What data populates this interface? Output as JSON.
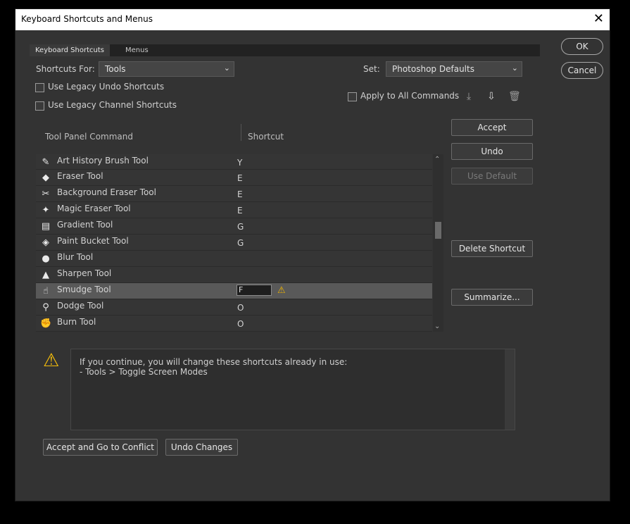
{
  "window": {
    "title": "Keyboard Shortcuts and Menus",
    "close_glyph": "✕"
  },
  "tabs": [
    {
      "label": "Keyboard Shortcuts",
      "active": true
    },
    {
      "label": "Menus",
      "active": false
    }
  ],
  "shortcuts_for": {
    "label": "Shortcuts For:",
    "value": "Tools"
  },
  "set": {
    "label": "Set:",
    "value": "Photoshop Defaults"
  },
  "options": {
    "legacy_undo": "Use Legacy Undo Shortcuts",
    "legacy_channel": "Use Legacy Channel Shortcuts",
    "apply_all": "Apply to All Commands"
  },
  "columns": {
    "command": "Tool Panel Command",
    "shortcut": "Shortcut"
  },
  "rows": [
    {
      "name": "Art History Brush Tool",
      "key": "Y",
      "icon": "art-history-brush-icon",
      "glyph": "✎"
    },
    {
      "name": "Eraser Tool",
      "key": "E",
      "icon": "eraser-icon",
      "glyph": "◆"
    },
    {
      "name": "Background Eraser Tool",
      "key": "E",
      "icon": "background-eraser-icon",
      "glyph": "✂"
    },
    {
      "name": "Magic Eraser Tool",
      "key": "E",
      "icon": "magic-eraser-icon",
      "glyph": "✦"
    },
    {
      "name": "Gradient Tool",
      "key": "G",
      "icon": "gradient-icon",
      "glyph": "▤"
    },
    {
      "name": "Paint Bucket Tool",
      "key": "G",
      "icon": "paint-bucket-icon",
      "glyph": "◈"
    },
    {
      "name": "Blur Tool",
      "key": "",
      "icon": "blur-icon",
      "glyph": "💧"
    },
    {
      "name": "Sharpen Tool",
      "key": "",
      "icon": "sharpen-icon",
      "glyph": "▲"
    },
    {
      "name": "Smudge Tool",
      "key": "F",
      "icon": "smudge-icon",
      "glyph": "☝",
      "selected": true
    },
    {
      "name": "Dodge Tool",
      "key": "O",
      "icon": "dodge-icon",
      "glyph": "⚲"
    },
    {
      "name": "Burn Tool",
      "key": "O",
      "icon": "burn-icon",
      "glyph": "✊"
    }
  ],
  "buttons": {
    "ok": "OK",
    "cancel": "Cancel",
    "accept": "Accept",
    "undo": "Undo",
    "use_default": "Use Default",
    "delete_shortcut": "Delete Shortcut",
    "summarize": "Summarize...",
    "accept_conflict": "Accept and Go to Conflict",
    "undo_changes": "Undo Changes"
  },
  "message": {
    "line1": "If you continue, you will change these shortcuts already in use:",
    "line2": "- Tools > Toggle Screen Modes"
  },
  "colors": {
    "warning": "#f4bd0b",
    "selected_row": "#595959"
  }
}
